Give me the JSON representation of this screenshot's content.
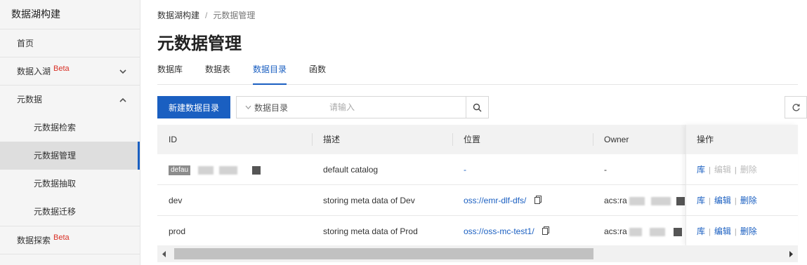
{
  "sidebar": {
    "title": "数据湖构建",
    "items": [
      {
        "label": "首页"
      },
      {
        "label": "数据入湖",
        "badge": "Beta",
        "chevron": "chevron-down"
      },
      {
        "label": "元数据",
        "chevron": "chevron-up"
      },
      {
        "label": "数据探索",
        "badge": "Beta"
      }
    ],
    "sub_items": [
      {
        "label": "元数据检索"
      },
      {
        "label": "元数据管理",
        "active": true
      },
      {
        "label": "元数据抽取"
      },
      {
        "label": "元数据迁移"
      }
    ]
  },
  "breadcrumb": {
    "root": "数据湖构建",
    "separator": "/",
    "current": "元数据管理"
  },
  "page_title": "元数据管理",
  "tabs": [
    {
      "label": "数据库"
    },
    {
      "label": "数据表"
    },
    {
      "label": "数据目录",
      "active": true
    },
    {
      "label": "函数"
    }
  ],
  "toolbar": {
    "create_label": "新建数据目录",
    "search_type": "数据目录",
    "search_placeholder": "请输入"
  },
  "table": {
    "columns": [
      "ID",
      "描述",
      "位置",
      "Owner",
      "操作"
    ],
    "rows": [
      {
        "id_badge": "defau",
        "description": "default catalog",
        "location": "-",
        "owner": "-",
        "ops": [
          {
            "label": "库",
            "enabled": true
          },
          {
            "label": "编辑",
            "enabled": false
          },
          {
            "label": "删除",
            "enabled": false
          }
        ]
      },
      {
        "id": "dev",
        "description": "storing meta data of Dev",
        "location": "oss://emr-dlf-dfs/",
        "owner": "acs:ra",
        "ops": [
          {
            "label": "库",
            "enabled": true
          },
          {
            "label": "编辑",
            "enabled": true
          },
          {
            "label": "删除",
            "enabled": true
          }
        ]
      },
      {
        "id": "prod",
        "description": "storing meta data of Prod",
        "location": "oss://oss-mc-test1/",
        "owner": "acs:ra",
        "ops": [
          {
            "label": "库",
            "enabled": true
          },
          {
            "label": "编辑",
            "enabled": true
          },
          {
            "label": "删除",
            "enabled": true
          }
        ]
      }
    ]
  },
  "colors": {
    "primary": "#1a5fc1",
    "beta": "#d93026",
    "sidebar_bg": "#f5f5f5",
    "header_bg": "#f2f2f2"
  }
}
